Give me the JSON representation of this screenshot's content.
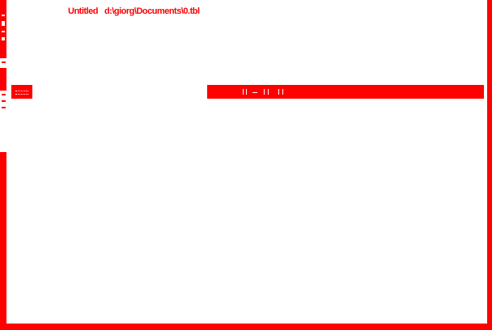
{
  "window": {
    "title_prefix": "Untitled",
    "file_path": "d:\\giorg\\Documents\\0.tbl"
  },
  "colors": {
    "accent": "#ff0000",
    "background": "#ffffff"
  }
}
